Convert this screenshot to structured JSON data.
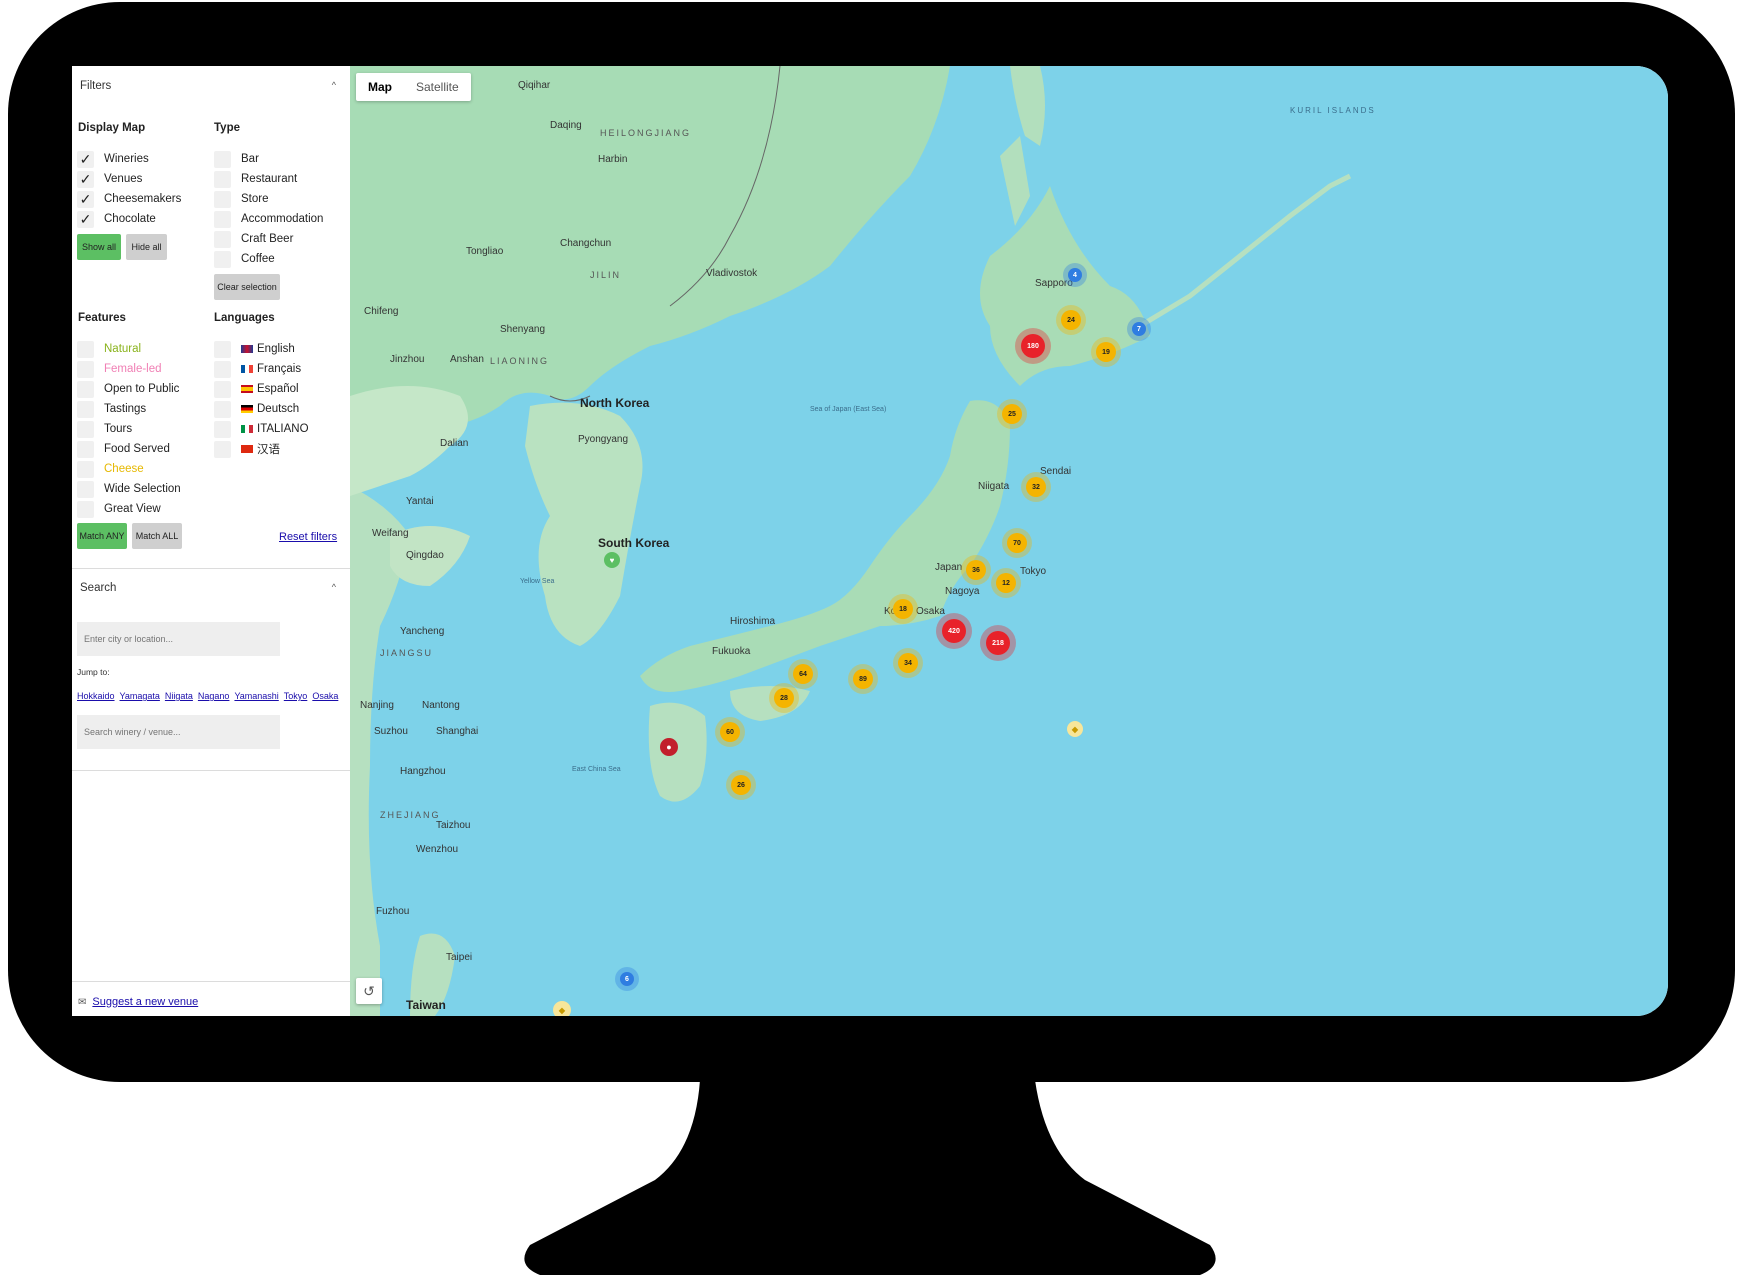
{
  "filters": {
    "title": "Filters",
    "display_map": {
      "title": "Display Map",
      "items": [
        "Wineries",
        "Venues",
        "Cheesemakers",
        "Chocolate"
      ],
      "show_all": "Show all",
      "hide_all": "Hide all"
    },
    "type": {
      "title": "Type",
      "items": [
        "Bar",
        "Restaurant",
        "Store",
        "Accommodation",
        "Craft Beer",
        "Coffee"
      ],
      "clear": "Clear selection"
    },
    "features": {
      "title": "Features",
      "items": [
        "Natural",
        "Female-led",
        "Open to Public",
        "Tastings",
        "Tours",
        "Food Served",
        "Cheese",
        "Wide Selection",
        "Great View"
      ],
      "match_any": "Match ANY",
      "match_all": "Match ALL",
      "reset": "Reset filters"
    },
    "languages": {
      "title": "Languages",
      "items": [
        "English",
        "Français",
        "Español",
        "Deutsch",
        "ITALIANO",
        "汉语"
      ]
    },
    "colors": {
      "natural": "#8ab31c",
      "female_led": "#f07fb4",
      "cheese": "#e6b800"
    }
  },
  "search": {
    "title": "Search",
    "city_placeholder": "Enter city or location...",
    "jump_label": "Jump to:",
    "jump_links": [
      "Hokkaido",
      "Yamagata",
      "Niigata",
      "Nagano",
      "Yamanashi",
      "Tokyo",
      "Osaka"
    ],
    "venue_placeholder": "Search winery / venue..."
  },
  "footer": {
    "suggest": "Suggest a new venue"
  },
  "map": {
    "tabs": [
      "Map",
      "Satellite"
    ],
    "labels": {
      "qiqihar": "Qiqihar",
      "heilongjiang": "HEILONGJIANG",
      "harbin": "Harbin",
      "changchun": "Changchun",
      "jilin": "JILIN",
      "vladivostok": "Vladivostok",
      "tongliao": "Tongliao",
      "chifeng": "Chifeng",
      "shenyang": "Shenyang",
      "liaoning": "LIAONING",
      "jinzhou": "Jinzhou",
      "anshan": "Anshan",
      "north_korea": "North Korea",
      "pyongyang": "Pyongyang",
      "south_korea": "South Korea",
      "dalian": "Dalian",
      "yantai": "Yantai",
      "weifang": "Weifang",
      "qingdao": "Qingdao",
      "jiangsu": "JIANGSU",
      "yancheng": "Yancheng",
      "nanjing": "Nanjing",
      "nantong": "Nantong",
      "suzhou": "Suzhou",
      "shanghai": "Shanghai",
      "hangzhou": "Hangzhou",
      "zhejiang": "ZHEJIANG",
      "taizhou": "Taizhou",
      "wenzhou": "Wenzhou",
      "fuzhou": "Fuzhou",
      "taipei": "Taipei",
      "taiwan": "Taiwan",
      "sapporo": "Sapporo",
      "niigata": "Niigata",
      "sendai": "Sendai",
      "tokyo": "Tokyo",
      "nagoya": "Nagoya",
      "kobe": "Kobe",
      "osaka": "Osaka",
      "hiroshima": "Hiroshima",
      "fukuoka": "Fukuoka",
      "japan": "Japan",
      "sea_of_japan": "Sea of Japan (East Sea)",
      "yellow_sea": "Yellow Sea",
      "east_china_sea": "East China Sea",
      "kuril": "KURIL ISLANDS",
      "daqing": "Daqing"
    },
    "clusters": [
      {
        "label": "4",
        "color": "blue"
      },
      {
        "label": "24",
        "color": "yellow"
      },
      {
        "label": "7",
        "color": "blue"
      },
      {
        "label": "180",
        "color": "red"
      },
      {
        "label": "19",
        "color": "yellow"
      },
      {
        "label": "25",
        "color": "yellow"
      },
      {
        "label": "32",
        "color": "yellow"
      },
      {
        "label": "70",
        "color": "yellow"
      },
      {
        "label": "36",
        "color": "yellow"
      },
      {
        "label": "12",
        "color": "yellow"
      },
      {
        "label": "18",
        "color": "yellow"
      },
      {
        "label": "420",
        "color": "red"
      },
      {
        "label": "218",
        "color": "red"
      },
      {
        "label": "34",
        "color": "yellow"
      },
      {
        "label": "89",
        "color": "yellow"
      },
      {
        "label": "64",
        "color": "yellow"
      },
      {
        "label": "28",
        "color": "yellow"
      },
      {
        "label": "60",
        "color": "yellow"
      },
      {
        "label": "26",
        "color": "yellow"
      },
      {
        "label": "6",
        "color": "blue"
      }
    ]
  }
}
